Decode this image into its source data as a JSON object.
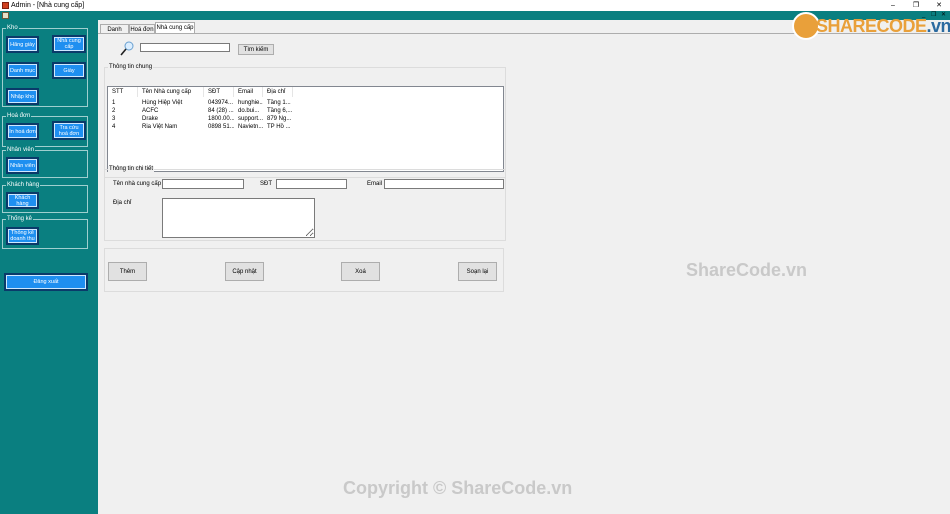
{
  "window": {
    "title": "Admin - [Nhà cung cấp]",
    "controls": [
      "–",
      "❐",
      "✕"
    ],
    "mdi_controls": [
      "_",
      "❐",
      "✕"
    ]
  },
  "sidebar": {
    "groups": [
      {
        "title": "Kho",
        "buttons": [
          "Hãng giày",
          "Nhà cung cấp",
          "Danh mục",
          "Giày",
          "Nhập kho"
        ]
      },
      {
        "title": "Hoá đơn",
        "buttons": [
          "In hoá đơn",
          "Tra cứu hoá đơn"
        ]
      },
      {
        "title": "Nhân viên",
        "buttons": [
          "Nhân viên"
        ]
      },
      {
        "title": "Khách hàng",
        "buttons": [
          "Khách hàng"
        ]
      },
      {
        "title": "Thống kê",
        "buttons": [
          "Thống kê doanh thu"
        ]
      }
    ],
    "logout_label": "Đăng xuất"
  },
  "tabs": [
    {
      "label": "Danh mục",
      "active": false
    },
    {
      "label": "Hoá đơn",
      "active": false
    },
    {
      "label": "Nhà cung cấp",
      "active": true
    }
  ],
  "search": {
    "value": "",
    "button_label": "Tìm kiếm"
  },
  "general": {
    "legend": "Thông tin chung",
    "columns": [
      "STT",
      "Tên Nhà cung cấp",
      "SĐT",
      "Email",
      "Địa chỉ"
    ],
    "rows": [
      [
        "1",
        "Hùng Hiệp Việt",
        "043974...",
        "hunghie...",
        "Tầng 1..."
      ],
      [
        "2",
        "ACFC",
        "84 (28) ...",
        "do.bui...",
        "Tầng 6,..."
      ],
      [
        "3",
        "Drake",
        "1800.00...",
        "support...",
        "879 Ng..."
      ],
      [
        "4",
        "Ria Việt Nam",
        "0898 51...",
        "Navietn...",
        "TP Hồ ..."
      ]
    ]
  },
  "detail": {
    "legend": "Thông tin chi tiết",
    "name_label": "Tên nhà cung cấp",
    "phone_label": "SĐT",
    "email_label": "Email",
    "address_label": "Địa chỉ",
    "name_value": "",
    "phone_value": "",
    "email_value": "",
    "address_value": ""
  },
  "actions": {
    "add": "Thêm",
    "update": "Cập nhật",
    "delete": "Xoá",
    "reset": "Soạn lại"
  },
  "watermarks": {
    "logo_text_a": "SHARECODE",
    "logo_text_b": ".vn",
    "middle": "ShareCode.vn",
    "copyright": "Copyright © ShareCode.vn"
  }
}
